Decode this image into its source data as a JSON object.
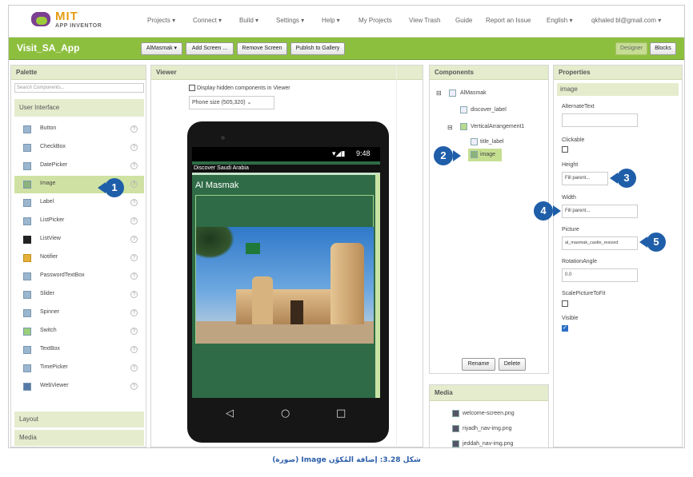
{
  "nav": {
    "logo_top": "MIT",
    "logo_bottom": "APP INVENTOR",
    "items": [
      "Projects ▾",
      "Connect ▾",
      "Build ▾",
      "Settings ▾",
      "Help ▾",
      "My Projects",
      "View Trash",
      "Guide",
      "Report an Issue",
      "English ▾",
      "qkhaled bl@gmail.com ▾"
    ]
  },
  "appbar": {
    "title": "Visit_SA_App",
    "screen_btn": "AlMasmak ▾",
    "add_screen": "Add Screen ...",
    "remove_screen": "Remove Screen",
    "publish": "Publish to Gallery",
    "designer": "Designer",
    "blocks": "Blocks"
  },
  "palette": {
    "title": "Palette",
    "search_placeholder": "Search Components...",
    "category_ui": "User Interface",
    "items": [
      "Button",
      "CheckBox",
      "DatePicker",
      "Image",
      "Label",
      "ListPicker",
      "ListView",
      "Notifier",
      "PasswordTextBox",
      "Slider",
      "Spinner",
      "Switch",
      "TextBox",
      "TimePicker",
      "WebViewer"
    ],
    "help_glyph": "?",
    "category_layout": "Layout",
    "category_media": "Media"
  },
  "viewer": {
    "title": "Viewer",
    "hidden_label": "Display hidden components in Viewer",
    "phone_size": "Phone size (505,320)",
    "status_time": "9:48",
    "app_title": "Discover Saudi Arabia",
    "label_text": "Al Masmak"
  },
  "components": {
    "title": "Components",
    "tree": [
      "AlMasmak",
      "discover_label",
      "VerticalArrangement1",
      "title_label",
      "image"
    ],
    "expand": "⊟",
    "rename": "Rename",
    "delete": "Delete"
  },
  "media": {
    "title": "Media",
    "files": [
      "welcome-screen.png",
      "riyadh_nav-img.png",
      "jeddah_nav-img.png"
    ]
  },
  "properties": {
    "title": "Properties",
    "component": "image",
    "alternate_text_label": "AlternateText",
    "alternate_text_value": "",
    "clickable_label": "Clickable",
    "clickable_checked": false,
    "height_label": "Height",
    "height_value": "Fill parent...",
    "width_label": "Width",
    "width_value": "Fill parent...",
    "picture_label": "Picture",
    "picture_value": "al_masmak_castle_resized",
    "rotation_label": "RotationAngle",
    "rotation_value": "0.0",
    "scale_label": "ScalePictureToFit",
    "scale_checked": false,
    "visible_label": "Visible",
    "visible_checked": true
  },
  "badges": [
    "1",
    "2",
    "3",
    "4",
    "5"
  ],
  "caption": "شكل 3.28: إضافة المُكوّن Image (صورة)",
  "colors": {
    "accent_green": "#8dbf3f",
    "badge_blue": "#1f5ea8",
    "phone_screen": "#2e6b46"
  }
}
